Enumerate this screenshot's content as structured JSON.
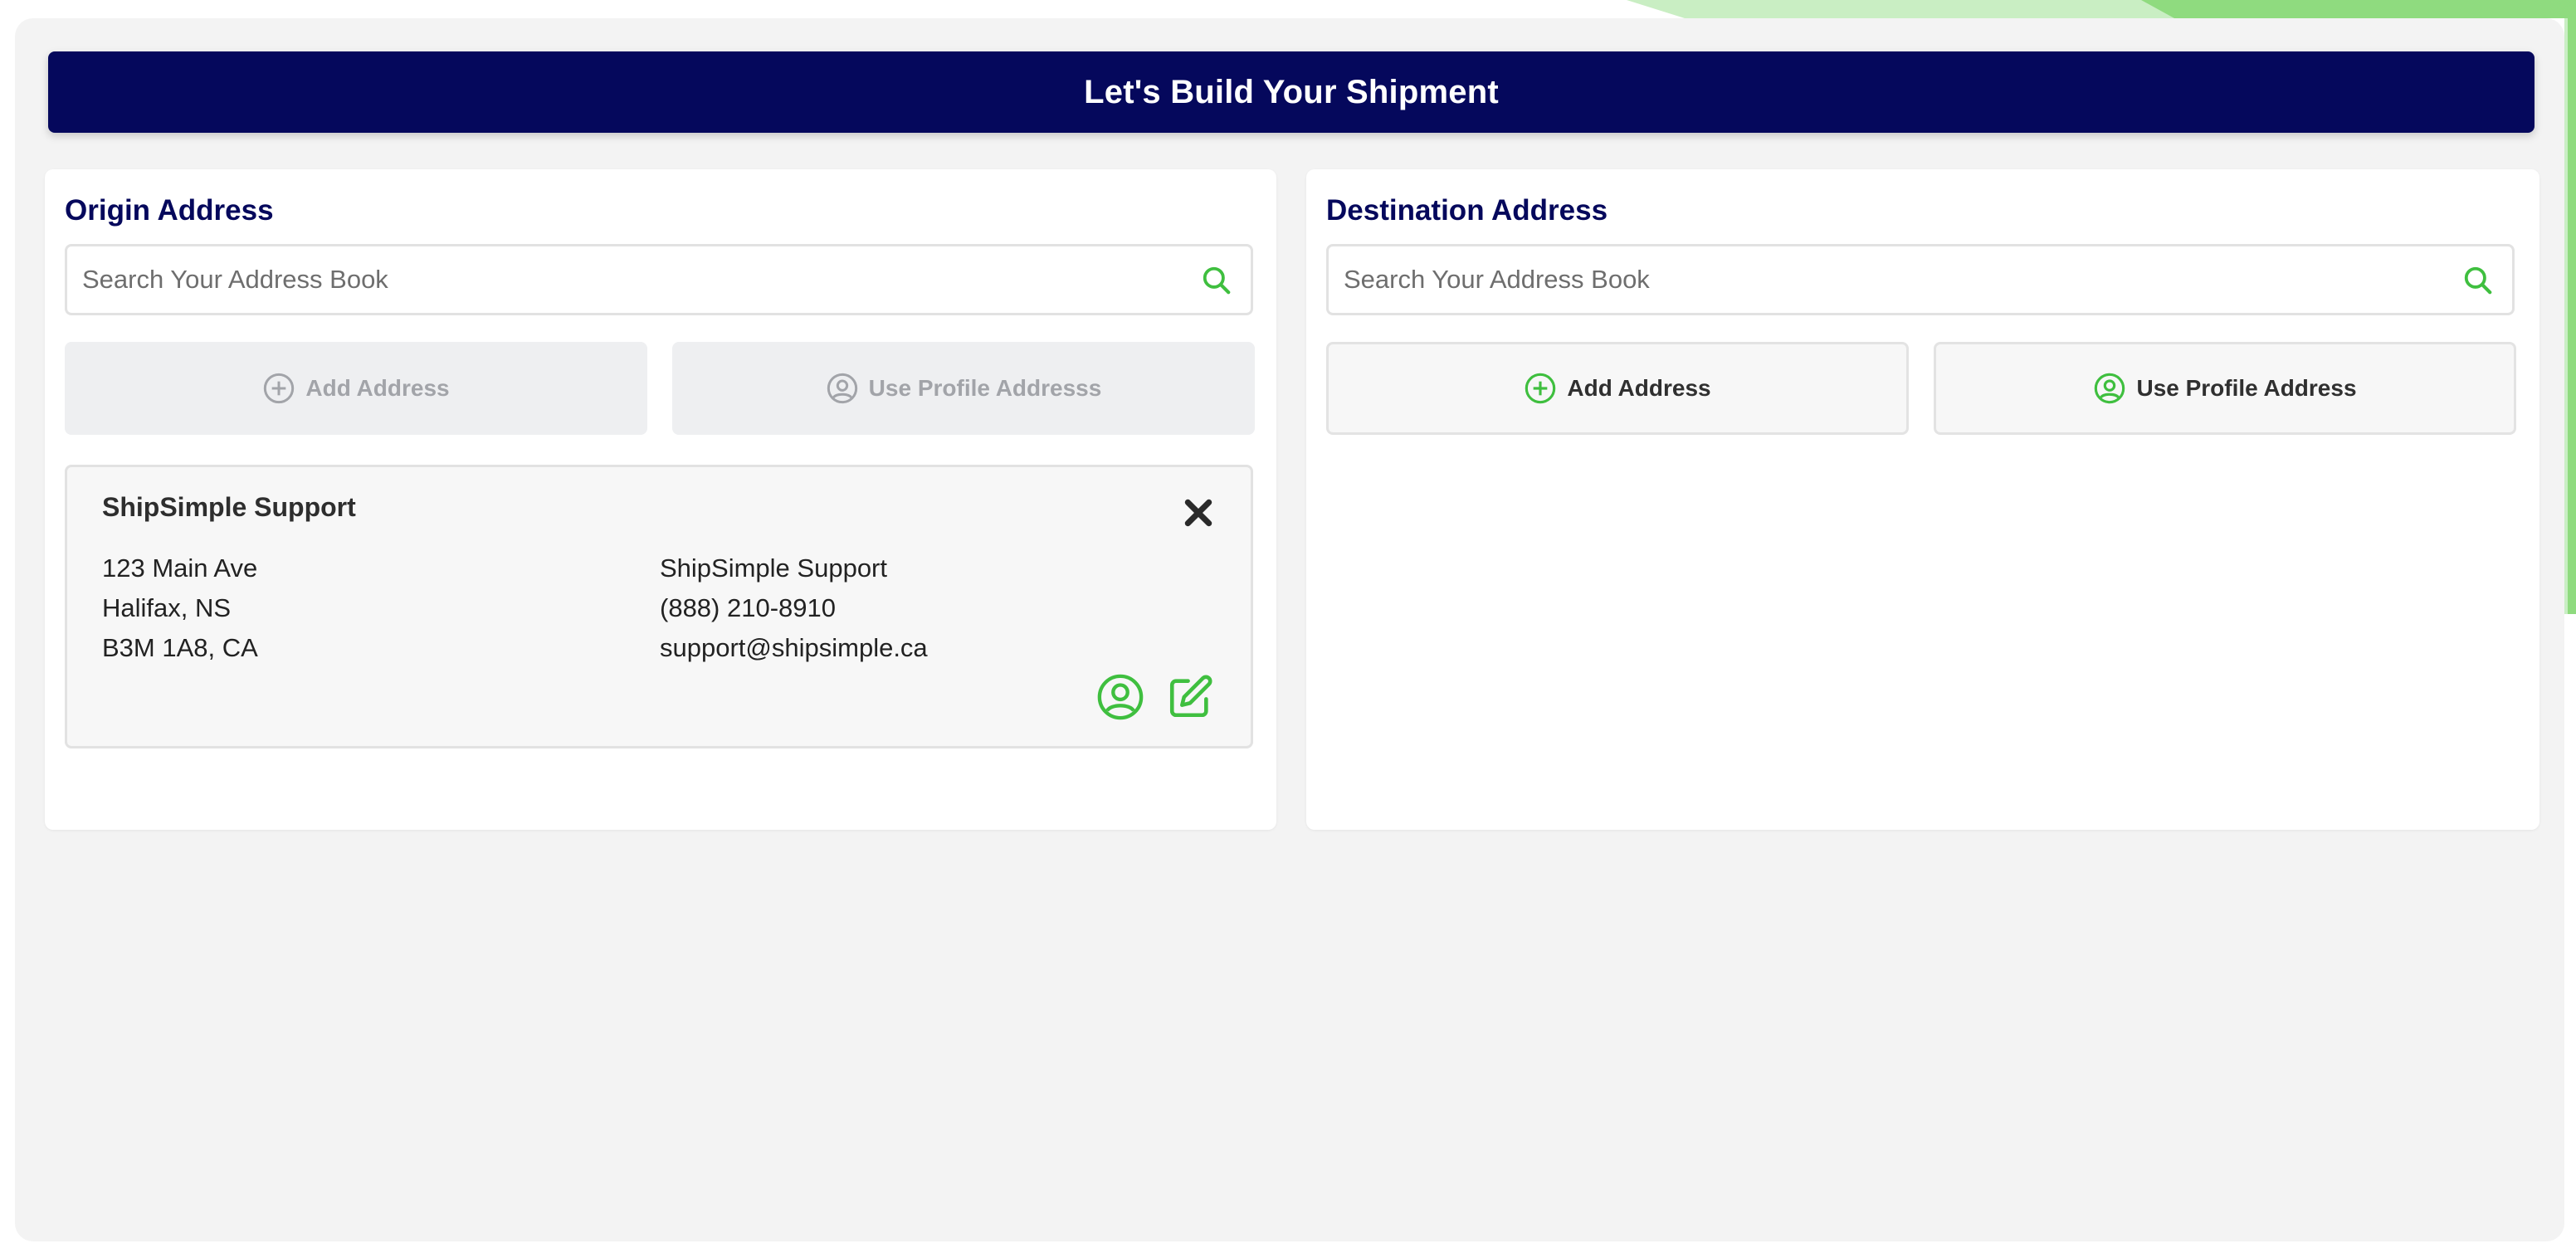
{
  "header": {
    "title": "Let's Build Your Shipment"
  },
  "colors": {
    "navy": "#05085c",
    "accent_green": "#3fbf3f",
    "disabled_text": "#a2a4a9",
    "background": "#f3f3f3"
  },
  "origin": {
    "title": "Origin Address",
    "search_placeholder": "Search Your Address Book",
    "add_address_label": "Add Address",
    "use_profile_label": "Use Profile Addresss",
    "buttons_state": "disabled",
    "selected_address": {
      "name": "ShipSimple Support",
      "street": "123 Main Ave",
      "city_province": "Halifax, NS",
      "postal_country": "B3M 1A8, CA",
      "contact_name": "ShipSimple Support",
      "phone": "(888) 210-8910",
      "email": "support@shipsimple.ca"
    }
  },
  "destination": {
    "title": "Destination Address",
    "search_placeholder": "Search Your Address Book",
    "add_address_label": "Add Address",
    "use_profile_label": "Use Profile Address",
    "buttons_state": "enabled"
  },
  "icons": {
    "search": "search-icon",
    "add": "plus-circle-icon",
    "profile": "user-circle-icon",
    "close": "close-icon",
    "edit": "edit-icon"
  }
}
